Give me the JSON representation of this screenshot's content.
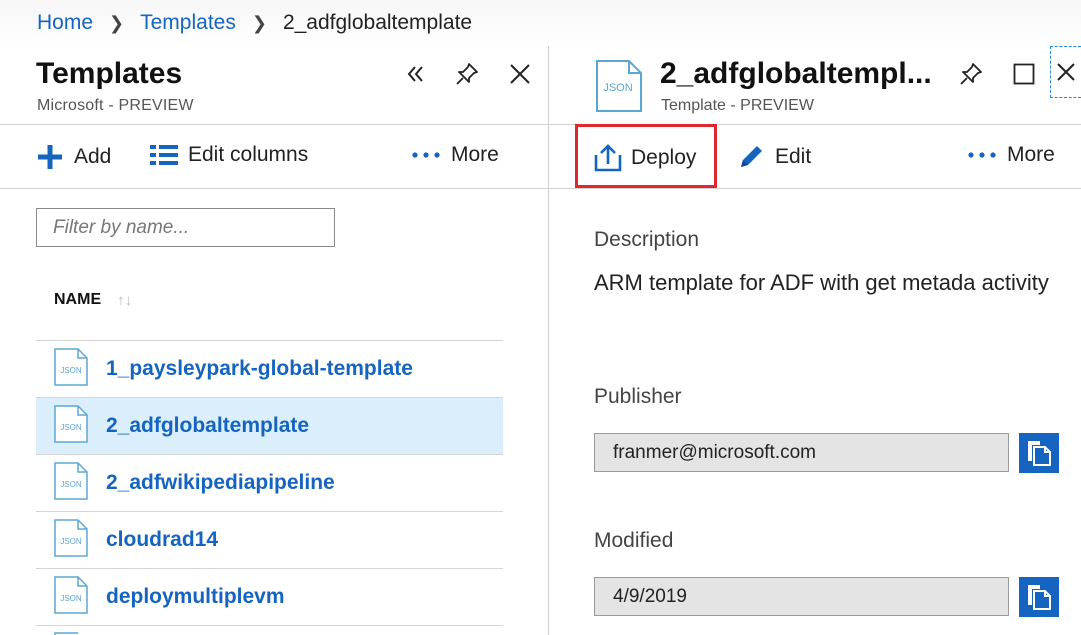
{
  "breadcrumb": {
    "home": "Home",
    "templates": "Templates",
    "current": "2_adfglobaltemplate"
  },
  "left_blade": {
    "title": "Templates",
    "subtitle": "Microsoft - PREVIEW",
    "commands": {
      "add": "Add",
      "edit_columns": "Edit columns",
      "more": "More"
    },
    "filter_placeholder": "Filter by name...",
    "column_header": "NAME",
    "items": [
      {
        "label": "1_paysleypark-global-template",
        "selected": false
      },
      {
        "label": "2_adfglobaltemplate",
        "selected": true
      },
      {
        "label": "2_adfwikipediapipeline",
        "selected": false
      },
      {
        "label": "cloudrad14",
        "selected": false
      },
      {
        "label": "deploymultiplevm",
        "selected": false
      }
    ]
  },
  "right_blade": {
    "icon_text": "JSON",
    "title": "2_adfglobaltempl...",
    "subtitle": "Template - PREVIEW",
    "commands": {
      "deploy": "Deploy",
      "edit": "Edit",
      "more": "More"
    },
    "description_label": "Description",
    "description": "ARM template for ADF with get metada activity",
    "publisher_label": "Publisher",
    "publisher": "franmer@microsoft.com",
    "modified_label": "Modified",
    "modified": "4/9/2019"
  },
  "icons": {
    "list_item_icon_text": "JSON"
  },
  "colors": {
    "accent": "#1565c0",
    "selected_row": "#dbeefb",
    "highlight_frame": "#e0262e"
  }
}
